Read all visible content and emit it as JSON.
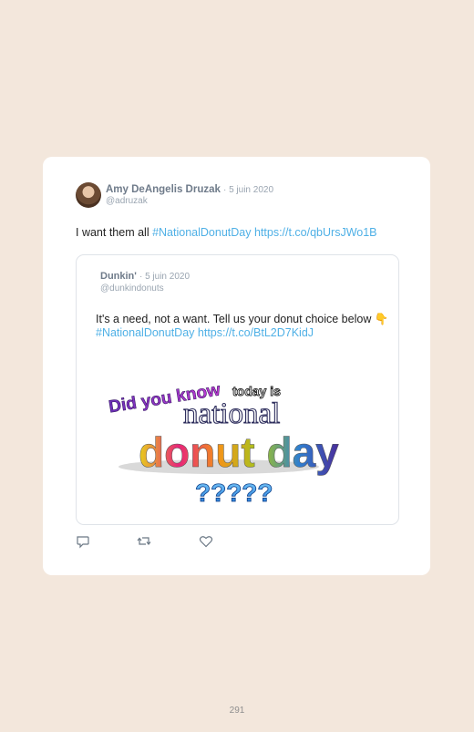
{
  "tweet": {
    "author_name": "Amy DeAngelis Druzak",
    "date": "· 5 juin 2020",
    "handle": "@adruzak",
    "text_plain": "I want them all ",
    "hashtag": "#NationalDonutDay",
    "link": "https://t.co/qbUrsJWo1B"
  },
  "quoted_tweet": {
    "author_name": "Dunkin'",
    "date": "· 5 juin 2020",
    "handle": "@dunkindonuts",
    "text_plain": "It's a need, not a want. Tell us your donut choice below ",
    "emoji": "👇",
    "hashtag": "#NationalDonutDay",
    "link": "https://t.co/BtL2D7KidJ",
    "image_text": {
      "line1": "Did you know",
      "line2": "today is",
      "line3": "national",
      "line4": "donut day",
      "line5": "?????"
    }
  },
  "actions": {
    "reply_icon": "reply-icon",
    "retweet_icon": "retweet-icon",
    "like_icon": "heart-icon"
  },
  "page": {
    "number": "291"
  },
  "colors": {
    "link": "#4fb0e6",
    "background": "#f3e7dc"
  }
}
